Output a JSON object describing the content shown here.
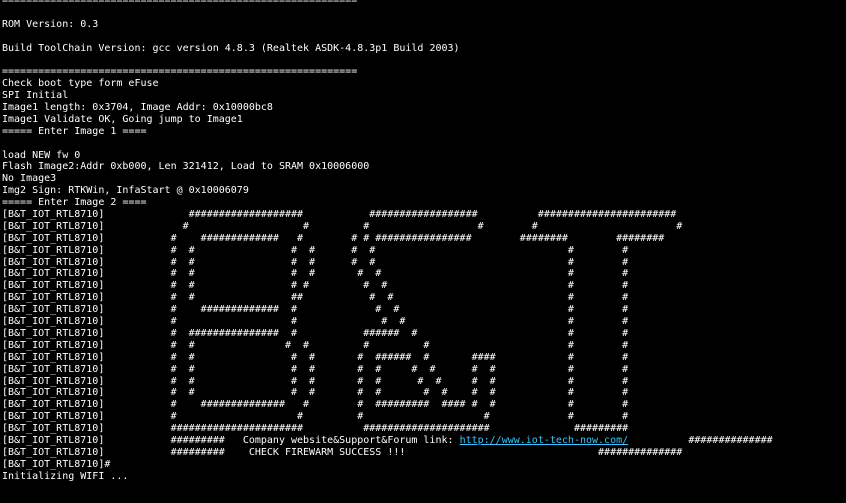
{
  "terminal": {
    "lines": [
      "===========================================================",
      "",
      "ROM Version: 0.3",
      "",
      "Build ToolChain Version: gcc version 4.8.3 (Realtek ASDK-4.8.3p1 Build 2003)",
      "",
      "===========================================================",
      "Check boot type form eFuse",
      "SPI Initial",
      "Image1 length: 0x3704, Image Addr: 0x10000bc8",
      "Image1 Validate OK, Going jump to Image1",
      "===== Enter Image 1 ====",
      "",
      "load NEW fw 0",
      "Flash Image2:Addr 0xb000, Len 321412, Load to SRAM 0x10006000",
      "No Image3",
      "Img2 Sign: RTKWin, InfaStart @ 0x10006079",
      "===== Enter Image 2 ====",
      "[B&T_IOT_RTL8710]              ###################           ##################          #######################",
      "[B&T_IOT_RTL8710]             #                   #         #                  #        #                       #",
      "[B&T_IOT_RTL8710]           #    #############   #        # # ################        ########        ########",
      "[B&T_IOT_RTL8710]           #  #                #  #      #  #                                #        #",
      "[B&T_IOT_RTL8710]           #  #                #  #      #  #                                #        #",
      "[B&T_IOT_RTL8710]           #  #                #  #       #  #                               #        #",
      "[B&T_IOT_RTL8710]           #  #                # #         #  #                              #        #",
      "[B&T_IOT_RTL8710]           #  #                ##           #  #                             #        #",
      "[B&T_IOT_RTL8710]           #    #############  #             #  #                            #        #",
      "[B&T_IOT_RTL8710]           #                   #              #  #                           #        #",
      "[B&T_IOT_RTL8710]           #  ###############  #           ######  #                         #        #",
      "[B&T_IOT_RTL8710]           #  #               #  #         #         #                       #        #",
      "[B&T_IOT_RTL8710]           #  #                #  #       #  ######  #       ####            #        #",
      "[B&T_IOT_RTL8710]           #  #                #  #       #  #     #  #      #  #            #        #",
      "[B&T_IOT_RTL8710]           #  #                #  #       #  #      #  #     #  #            #        #",
      "[B&T_IOT_RTL8710]           #  #                #  #       #  #       #  #    #  #            #        #",
      "[B&T_IOT_RTL8710]           #    ##############   #        #  #########  #### #  #            #        #",
      "[B&T_IOT_RTL8710]           #                    #         #                    #             #        #",
      "[B&T_IOT_RTL8710]           ######################          #####################              #########",
      "[B&T_IOT_RTL8710]           #########   Company website&Support&Forum link: ",
      "[B&T_IOT_RTL8710]           #########    CHECK FIREWARM SUCCESS !!!                                ##############",
      "[B&T_IOT_RTL8710]#",
      "Initializing WIFI ..."
    ],
    "forum_link": {
      "url": "http://www.iot-tech-now.com/",
      "suffix": "          ##############"
    },
    "text_color": "#ffffff",
    "link_color": "#35c7ff",
    "background": "#000000"
  }
}
